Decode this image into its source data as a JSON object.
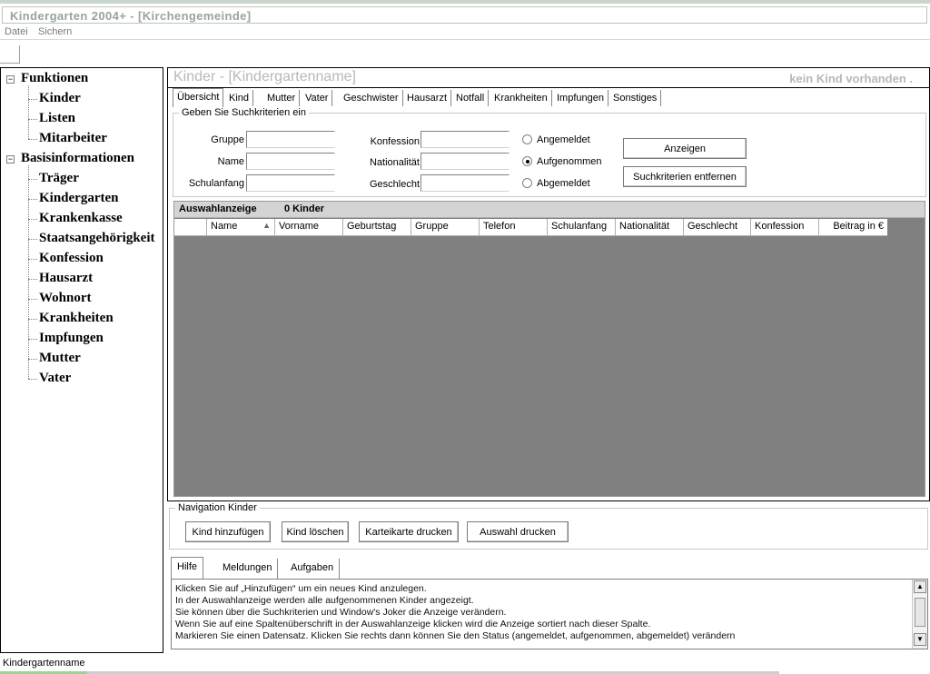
{
  "window": {
    "title": "Kindergarten 2004+ - [Kirchengemeinde]"
  },
  "menu": {
    "items": [
      "Datei",
      "Sichern"
    ]
  },
  "tree": {
    "groups": [
      {
        "label": "Funktionen",
        "items": [
          "Kinder",
          "Listen",
          "Mitarbeiter"
        ]
      },
      {
        "label": "Basisinformationen",
        "items": [
          "Träger",
          "Kindergarten",
          "Krankenkasse",
          "Staatsangehörigkeit",
          "Konfession",
          "Hausarzt",
          "Wohnort",
          "Krankheiten",
          "Impfungen",
          "Mutter",
          "Vater"
        ]
      }
    ]
  },
  "main": {
    "title": "Kinder - [Kindergartenname]",
    "status": "kein Kind vorhanden .",
    "tabs": [
      "Übersicht",
      "Kind",
      "Mutter",
      "Vater",
      "Geschwister",
      "Hausarzt",
      "Notfall",
      "Krankheiten",
      "Impfungen",
      "Sonstiges"
    ],
    "active_tab": "Übersicht",
    "search": {
      "legend": "Geben Sie Suchkriterien ein",
      "labels": {
        "gruppe": "Gruppe",
        "name": "Name",
        "schulanfang": "Schulanfang",
        "konfession": "Konfession",
        "nationalitaet": "Nationalität",
        "geschlecht": "Geschlecht"
      },
      "values": {
        "gruppe": "",
        "name": "",
        "schulanfang": "",
        "konfession": "",
        "nationalitaet": "",
        "geschlecht": ""
      },
      "radios": [
        "Angemeldet",
        "Aufgenommen",
        "Abgemeldet"
      ],
      "radio_selected": "Aufgenommen",
      "buttons": {
        "show": "Anzeigen",
        "clear": "Suchkriterien entfernen"
      }
    },
    "grid": {
      "caption": "Auswahlanzeige",
      "count": "0 Kinder",
      "columns": [
        "Name",
        "Vorname",
        "Geburtstag",
        "Gruppe",
        "Telefon",
        "Schulanfang",
        "Nationalität",
        "Geschlecht",
        "Konfession",
        "Beitrag in €"
      ],
      "rows": []
    }
  },
  "navigation": {
    "legend": "Navigation Kinder",
    "buttons": [
      "Kind hinzufügen",
      "Kind löschen",
      "Karteikarte drucken",
      "Auswahl drucken"
    ]
  },
  "help": {
    "tabs": [
      "Hilfe",
      "Meldungen",
      "Aufgaben"
    ],
    "active_tab": "Hilfe",
    "lines": [
      "Klicken Sie auf „Hinzufügen“ um ein neues Kind anzulegen.",
      "In der Auswahlanzeige werden alle aufgenommenen Kinder angezeigt.",
      "Sie können über die Suchkriterien und Window's Joker die Anzeige verändern.",
      "Wenn Sie auf eine Spaltenüberschrift in der Auswahlanzeige klicken wird die Anzeige sortiert nach dieser Spalte.",
      "Markieren Sie einen Datensatz. Klicken Sie rechts dann können Sie den Status (angemeldet, aufgenommen, abgemeldet) verändern"
    ]
  },
  "statusbar": {
    "text": "Kindergartenname"
  }
}
